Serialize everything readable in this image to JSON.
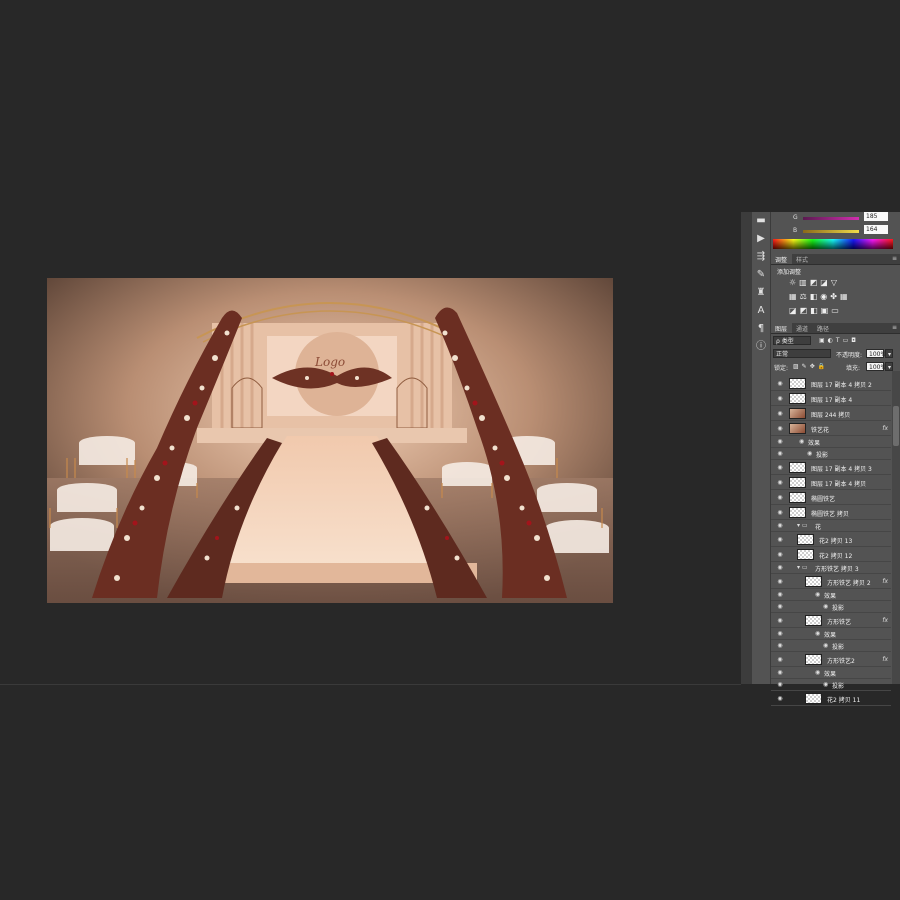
{
  "color_panel": {
    "channels": [
      {
        "label": "G",
        "value": "185",
        "color": "#a21f7a"
      },
      {
        "label": "B",
        "value": "164",
        "color": "#d8c43a"
      }
    ]
  },
  "adjustments_panel": {
    "tabs": [
      {
        "label": "调整",
        "active": true
      },
      {
        "label": "样式",
        "active": false
      }
    ],
    "title": "添加调整"
  },
  "layers_panel": {
    "tabs": [
      {
        "label": "图层",
        "active": true
      },
      {
        "label": "通道",
        "active": false
      },
      {
        "label": "路径",
        "active": false
      }
    ],
    "filter_kind": "ρ 类型",
    "blend_mode": "正常",
    "opacity_label": "不透明度:",
    "opacity_value": "100%",
    "lock_label": "锁定:",
    "fill_label": "填充:",
    "fill_value": "100%",
    "layers": [
      {
        "name": "图层 17 副本 4 拷贝 2",
        "type": "layer",
        "fx": false
      },
      {
        "name": "图层 17 副本 4",
        "type": "layer",
        "fx": false
      },
      {
        "name": "图层 244 拷贝",
        "type": "layer",
        "fx": false
      },
      {
        "name": "铁艺花",
        "type": "layer",
        "fx": true
      },
      {
        "name": "效果",
        "type": "effect-group"
      },
      {
        "name": "投影",
        "type": "effect"
      },
      {
        "name": "图层 17 副本 4 拷贝 3",
        "type": "layer",
        "fx": false
      },
      {
        "name": "图层 17 副本 4 拷贝",
        "type": "layer",
        "fx": false
      },
      {
        "name": "椭圆铁艺",
        "type": "layer",
        "fx": false
      },
      {
        "name": "椭圆铁艺 拷贝",
        "type": "layer",
        "fx": false
      },
      {
        "name": "花",
        "type": "group"
      },
      {
        "name": "花2 拷贝 13",
        "type": "layer",
        "fx": false
      },
      {
        "name": "花2 拷贝 12",
        "type": "layer",
        "fx": false
      },
      {
        "name": "方形铁艺 拷贝 3",
        "type": "group"
      },
      {
        "name": "方形铁艺 拷贝 2",
        "type": "layer",
        "fx": true
      },
      {
        "name": "效果",
        "type": "effect-group"
      },
      {
        "name": "投影",
        "type": "effect"
      },
      {
        "name": "方形铁艺",
        "type": "layer",
        "fx": true
      },
      {
        "name": "效果",
        "type": "effect-group"
      },
      {
        "name": "投影",
        "type": "effect"
      },
      {
        "name": "方形铁艺2",
        "type": "layer",
        "fx": true
      },
      {
        "name": "效果",
        "type": "effect-group"
      },
      {
        "name": "投影",
        "type": "effect"
      },
      {
        "name": "花2 拷贝 11",
        "type": "layer",
        "fx": false
      }
    ]
  },
  "icons": {
    "eye": "eye-icon",
    "fx": "fx",
    "folder": "folder-icon"
  }
}
